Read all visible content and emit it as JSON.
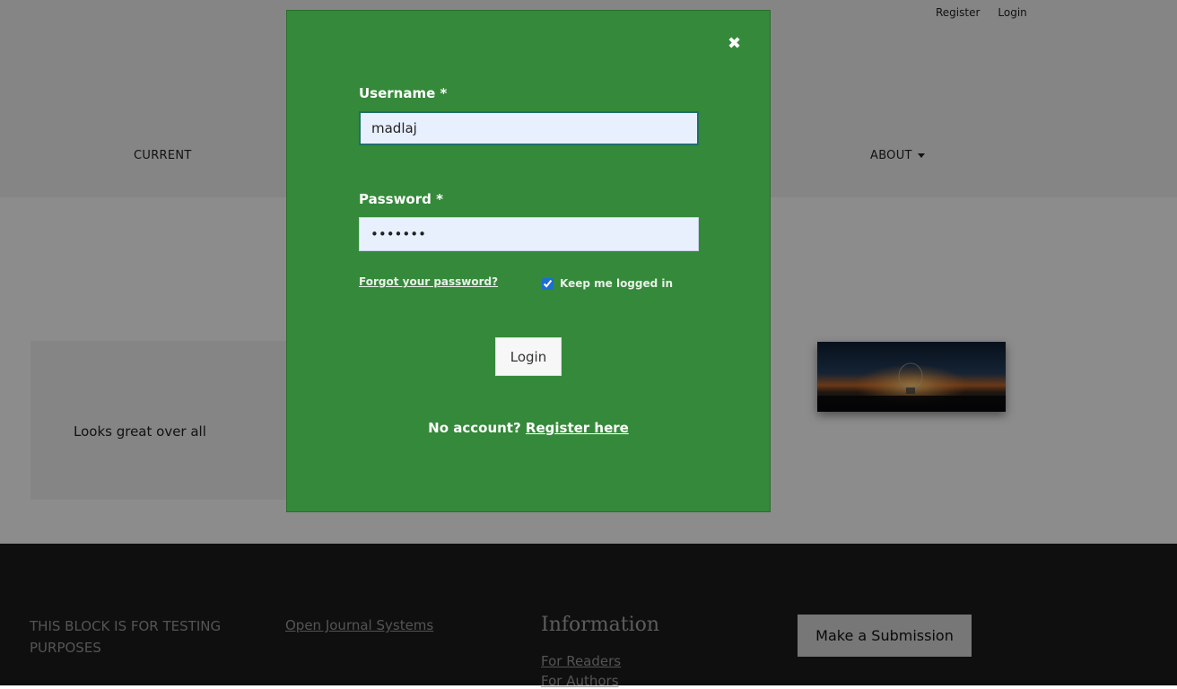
{
  "header": {
    "user_nav": {
      "register": "Register",
      "login": "Login"
    },
    "primary_nav": {
      "current": "CURRENT",
      "about": "ABOUT"
    }
  },
  "main": {
    "card_text": "Looks great over all"
  },
  "footer": {
    "block_text": "THIS BLOCK IS FOR TESTING PURPOSES",
    "ojs_link": "Open Journal Systems",
    "information": {
      "heading": "Information",
      "links": [
        "For Readers",
        "For Authors"
      ]
    },
    "submit_button": "Make a Submission"
  },
  "modal": {
    "close_icon": "close-icon",
    "username_label": "Username *",
    "username_value": "madlaj",
    "password_label": "Password *",
    "password_value": "•••••••",
    "forgot_link": "Forgot your password?",
    "remember_label": "Keep me logged in",
    "remember_checked": true,
    "login_button": "Login",
    "no_account_text": "No account?",
    "register_link": "Register here"
  },
  "colors": {
    "modal_bg": "#35893a",
    "input_bg": "#e8f0fe",
    "footer_bg": "#1c1c1c"
  }
}
